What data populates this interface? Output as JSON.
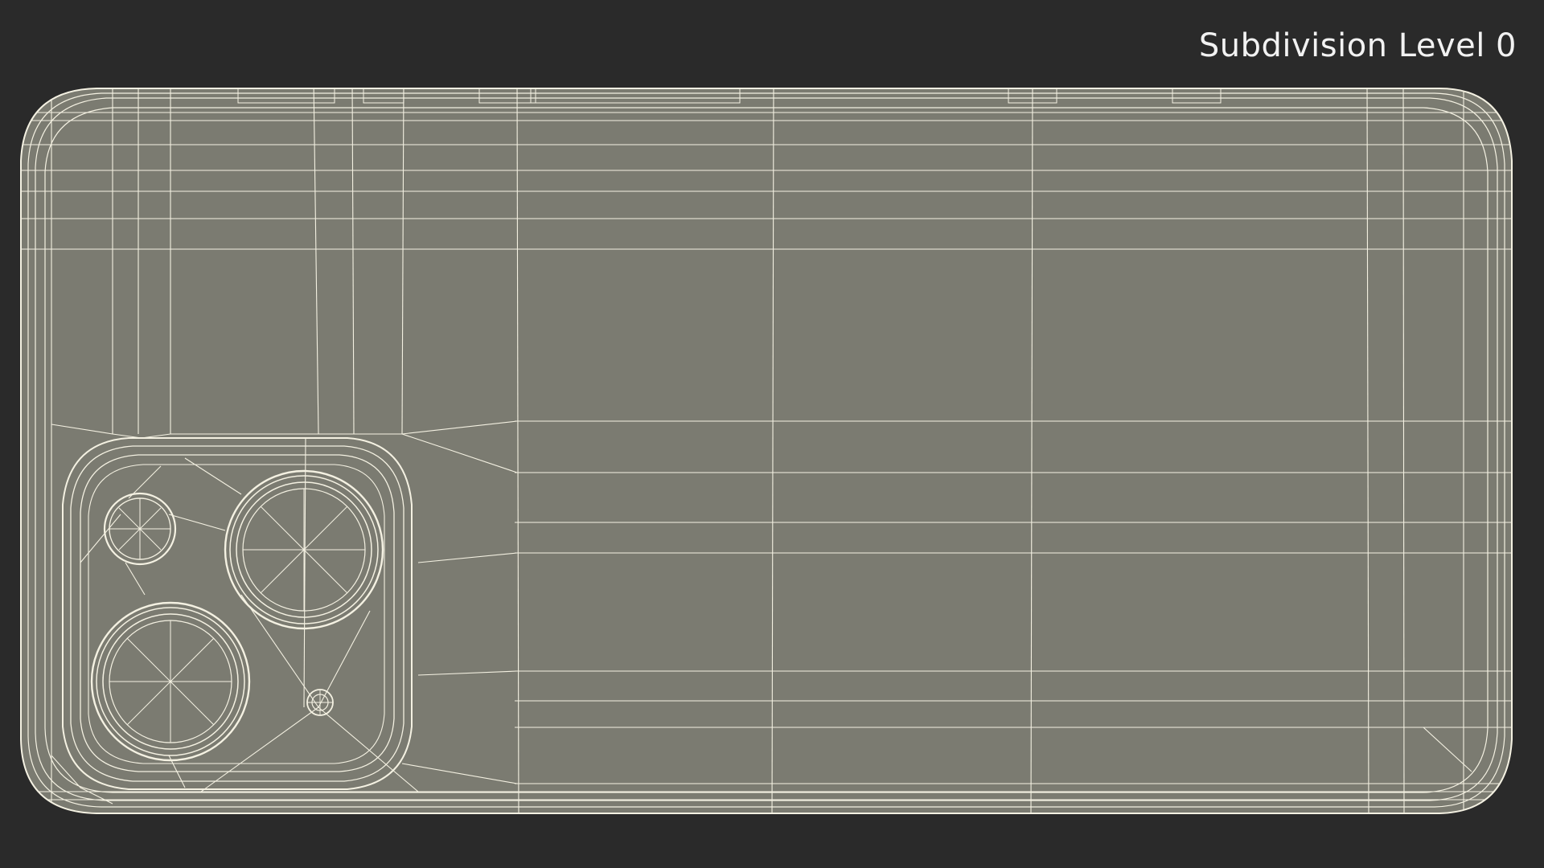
{
  "viewport": {
    "label": "Subdivision Level 0",
    "background": "#2a2a2a"
  },
  "model": {
    "name": "phone-back-wireframe",
    "surface_color": "#7b7b71",
    "wire_color": "#f4f1e2"
  }
}
